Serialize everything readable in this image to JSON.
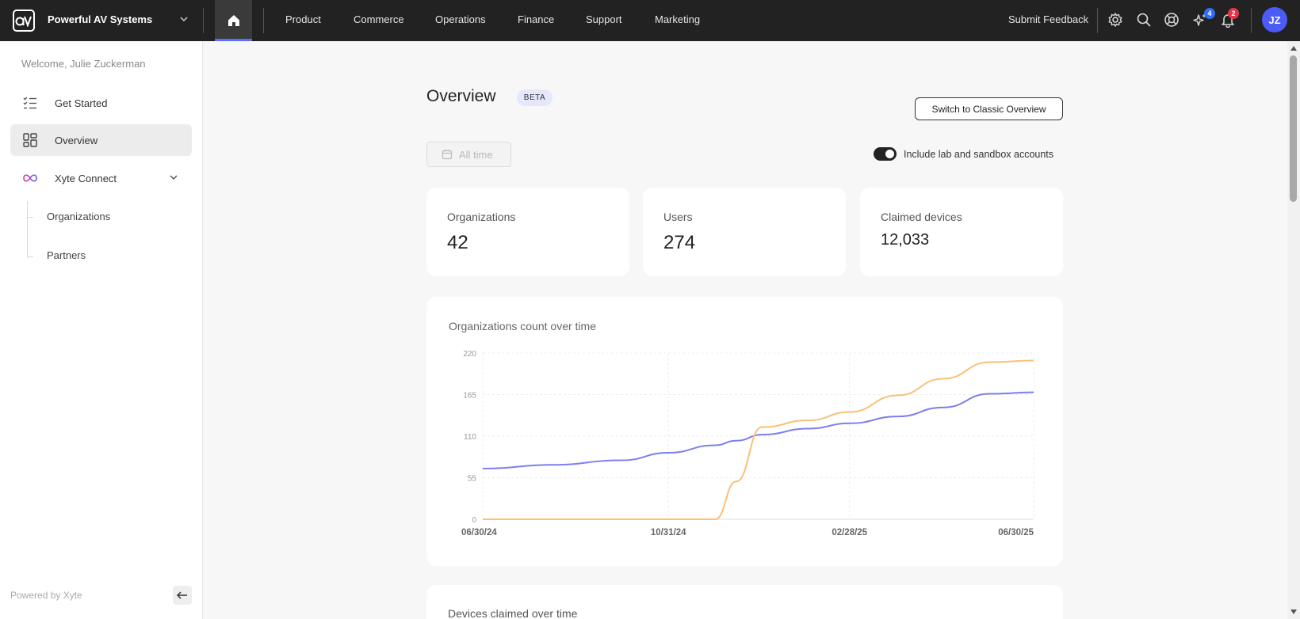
{
  "app": {
    "org_name": "Powerful AV Systems",
    "logo_text": "av",
    "nav": [
      "Product",
      "Commerce",
      "Operations",
      "Finance",
      "Support",
      "Marketing"
    ],
    "submit_feedback": "Submit Feedback",
    "ai_badge": "4",
    "notification_badge": "2",
    "avatar_initials": "JZ"
  },
  "sidebar": {
    "welcome": "Welcome, Julie Zuckerman",
    "items": [
      {
        "label": "Get Started",
        "icon": "checklist-icon"
      },
      {
        "label": "Overview",
        "icon": "dashboard-icon",
        "active": true
      },
      {
        "label": "Xyte Connect",
        "icon": "infinity-icon",
        "expanded": true
      }
    ],
    "subitems": [
      "Organizations",
      "Partners"
    ],
    "powered_by": "Powered by Xyte"
  },
  "main": {
    "title": "Overview",
    "beta": "BETA",
    "classic_button": "Switch to Classic Overview",
    "date_filter": "All time",
    "toggle_label": "Include lab and sandbox accounts",
    "toggle_on": true,
    "stats": [
      {
        "title": "Organizations",
        "value": "42"
      },
      {
        "title": "Users",
        "value": "274"
      },
      {
        "title": "Claimed devices",
        "value": "12,033"
      }
    ],
    "second_card_title": "Devices claimed over time"
  },
  "colors": {
    "accent": "#5b6cff",
    "series_blue": "#7b7ff0",
    "series_orange": "#fbbf77",
    "topbar": "#222222"
  },
  "chart_data": {
    "type": "line",
    "title": "Organizations count over time",
    "x_ticks": [
      "06/30/24",
      "10/31/24",
      "02/28/25",
      "06/30/25"
    ],
    "y_ticks": [
      "0",
      "55",
      "110",
      "165",
      "220"
    ],
    "ylim": [
      0,
      220
    ],
    "x": [
      "2024-06-30",
      "2024-08-15",
      "2024-09-30",
      "2024-10-31",
      "2024-12-01",
      "2024-12-15",
      "2025-01-01",
      "2025-02-01",
      "2025-02-28",
      "2025-04-01",
      "2025-05-01",
      "2025-06-01",
      "2025-06-30"
    ],
    "series": [
      {
        "values": [
          67,
          72,
          78,
          88,
          98,
          104,
          112,
          120,
          127,
          136,
          148,
          166,
          168
        ]
      },
      {
        "values": [
          0,
          0,
          0,
          0,
          0,
          50,
          122,
          131,
          142,
          164,
          186,
          208,
          210
        ]
      }
    ],
    "grid": true,
    "legend": "none"
  }
}
